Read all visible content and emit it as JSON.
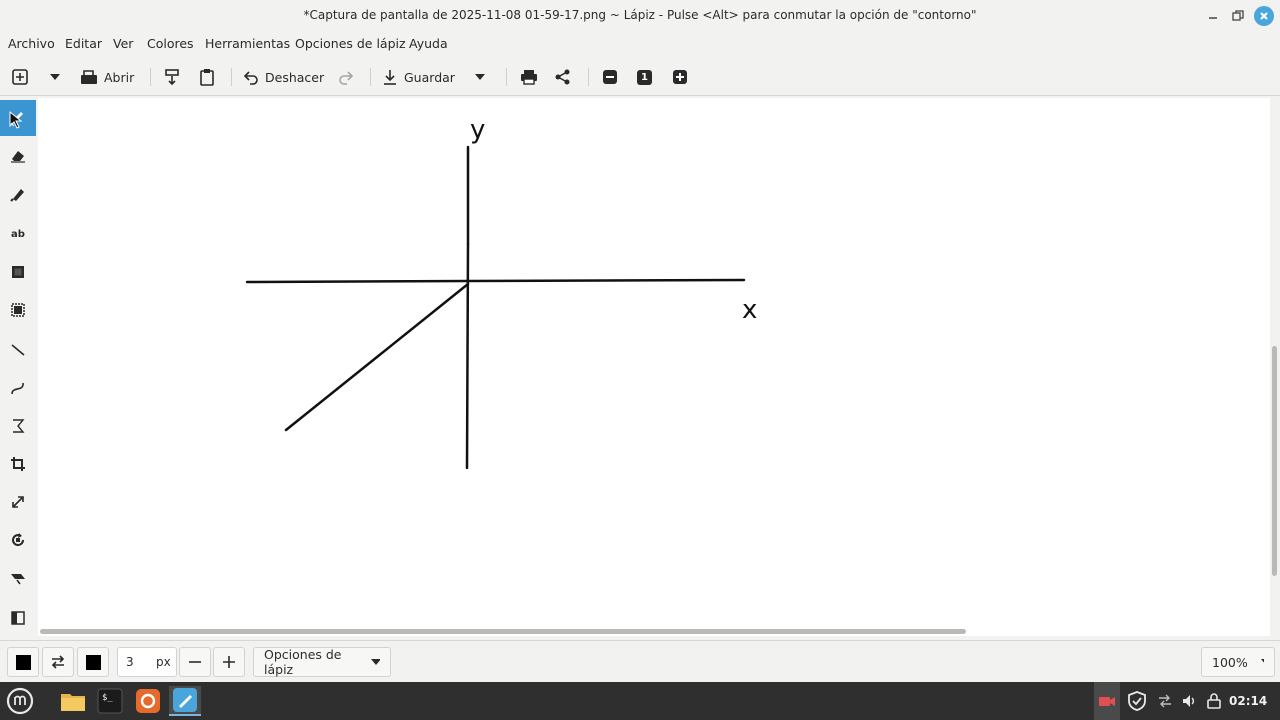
{
  "window": {
    "title": "*Captura de pantalla de 2025-11-08 01-59-17.png ~ Lápiz - Pulse <Alt> para conmutar la opción de \"contorno\""
  },
  "menu": [
    "Archivo",
    "Editar",
    "Ver",
    "Colores",
    "Herramientas",
    "Opciones de lápiz",
    "Ayuda"
  ],
  "toolbar": {
    "open_label": "Abrir",
    "undo_label": "Deshacer",
    "save_label": "Guardar",
    "zoom_preset": "1"
  },
  "canvas": {
    "y_label": "y",
    "x_label": "x"
  },
  "options": {
    "size_value": "3",
    "size_unit": "px",
    "tool_options_label": "Opciones de lápiz",
    "zoom_label": "100%"
  },
  "taskbar": {
    "clock": "02:14"
  },
  "colors": {
    "accent": "#3a95d0",
    "primary_color": "#000000",
    "secondary_color": "#000000"
  }
}
